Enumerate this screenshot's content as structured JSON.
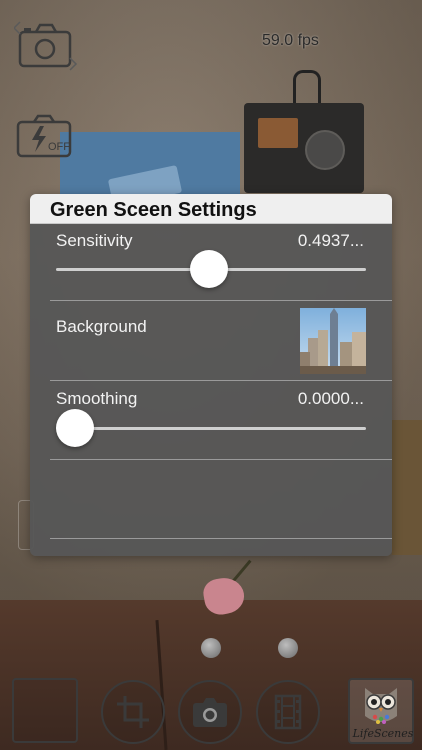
{
  "overlay": {
    "fps_label": "59.0 fps"
  },
  "icons": {
    "camera_top": "camera-icon",
    "flash_off": "flash-off-icon",
    "crop": "crop-icon",
    "capture": "camera-icon",
    "film": "film-icon",
    "owl": "owl-icon"
  },
  "panel": {
    "title": "Green Sceen Settings",
    "sensitivity": {
      "label": "Sensitivity",
      "value": "0.4937...",
      "level": 0.4937
    },
    "background": {
      "label": "Background"
    },
    "smoothing": {
      "label": "Smoothing",
      "value": "0.0000...",
      "level": 0.0
    }
  },
  "toolbar": {
    "brand": "LifeScenes"
  },
  "colors": {
    "panel_bg": "#565656",
    "header_bg": "#efefef",
    "track": "#cfcfcf",
    "thumb": "#ffffff"
  }
}
